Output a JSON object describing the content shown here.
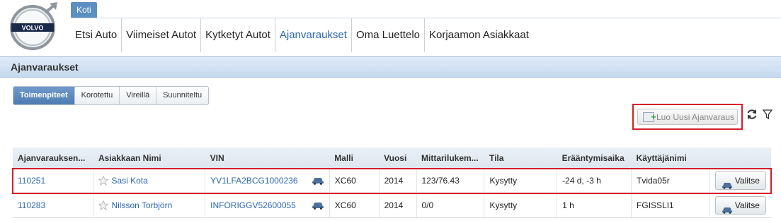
{
  "brand": {
    "logo_text": "VOLVO"
  },
  "home_tab": "Koti",
  "nav": [
    {
      "label": "Etsi Auto",
      "active": false
    },
    {
      "label": "Viimeiset Autot",
      "active": false
    },
    {
      "label": "Kytketyt Autot",
      "active": false
    },
    {
      "label": "Ajanvaraukset",
      "active": true
    },
    {
      "label": "Oma Luettelo",
      "active": false
    },
    {
      "label": "Korjaamon Asiakkaat",
      "active": false
    }
  ],
  "panel_title": "Ajanvaraukset",
  "subtabs": [
    {
      "label": "Toimenpiteet",
      "active": true
    },
    {
      "label": "Korotettu",
      "active": false
    },
    {
      "label": "Vireillä",
      "active": false
    },
    {
      "label": "Suunniteltu",
      "active": false
    }
  ],
  "new_button": "Luo Uusi Ajanvaraus",
  "columns": [
    "Ajanvarauksen...",
    "Asiakkaan Nimi",
    "VIN",
    "Malli",
    "Vuosi",
    "Mittarilukem...",
    "Tila",
    "Erääntymisaika",
    "Käyttäjänimi",
    ""
  ],
  "rows": [
    {
      "id": "110251",
      "name": "Sasi Kota",
      "vin": "YV1LFA2BCG1000236",
      "model": "XC60",
      "year": "2014",
      "odometer": "123/76.43",
      "status": "Kysytty",
      "due": "-24 d, -3 h",
      "user": "Tvida05r",
      "action": "Valitse"
    },
    {
      "id": "110283",
      "name": "Nilsson Torbjörn",
      "vin": "INFORIGGV52600055",
      "model": "XC60",
      "year": "2014",
      "odometer": "0/0",
      "status": "Kysytty",
      "due": "1 h",
      "user": "FGISSLI1",
      "action": "Valitse"
    }
  ],
  "colors": {
    "accent": "#2a67b0",
    "highlight": "#d41e2a",
    "header_bg": "#c7d9ee",
    "active_tab": "#5b8fc2"
  }
}
